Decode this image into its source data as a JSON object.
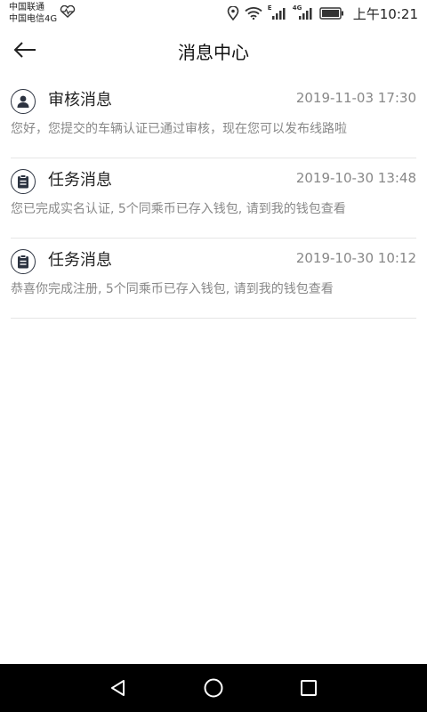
{
  "status_bar": {
    "carrier1": "中国联通",
    "carrier2": "中国电信4G",
    "net_label_1": "E",
    "net_label_2": "4G",
    "time": "上午10:21"
  },
  "header": {
    "title": "消息中心"
  },
  "messages": [
    {
      "icon": "user-review-icon",
      "title": "审核消息",
      "time": "2019-11-03 17:30",
      "body": "您好，您提交的车辆认证已通过审核，现在您可以发布线路啦"
    },
    {
      "icon": "clipboard-task-icon",
      "title": "任务消息",
      "time": "2019-10-30 13:48",
      "body": "您已完成实名认证, 5个同乘币已存入钱包, 请到我的钱包查看"
    },
    {
      "icon": "clipboard-task-icon",
      "title": "任务消息",
      "time": "2019-10-30 10:12",
      "body": "恭喜你完成注册, 5个同乘币已存入钱包, 请到我的钱包查看"
    }
  ],
  "nav_bar": {
    "back": "back-triangle-icon",
    "home": "home-circle-icon",
    "recents": "recents-square-icon"
  }
}
